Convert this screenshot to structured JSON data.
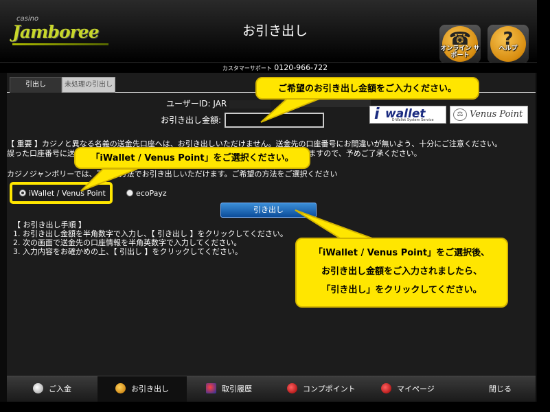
{
  "header": {
    "logo_small": "casino",
    "logo_main": "Jamboree",
    "title": "お引き出し",
    "online_support_label": "オンライン サポート",
    "help_label": "ヘルプ"
  },
  "support": {
    "label": "カスタマーサポート",
    "phone": "0120-966-722"
  },
  "tabs": {
    "withdraw": "引出し",
    "pending": "未処理の引出し"
  },
  "form": {
    "user_id_label": "ユーザーID: JAR",
    "amount_label": "お引き出し金額:",
    "amount_value": ""
  },
  "payment_logos": {
    "iwallet": "wallet",
    "iwallet_sub": "E-Wallet System Service",
    "venus": "Venus Point"
  },
  "notice": {
    "line1": "【 重要 】カジノと異なる名義の送金先口座へは、お引き出しいただけません。送金先の口座番号にお間違いが無いよう、十分にご注意ください。",
    "line2": "誤った口座番号に送金された場合のトラブルにつきましては、当カジノは責任を負いかねますので、予めご了承ください。",
    "line3": "カジノジャンボリーでは、下記の方法でお引き出しいただけます。ご希望の方法をご選択ください"
  },
  "methods": {
    "iwallet": "iWallet / Venus Point",
    "ecopayz": "ecoPayz",
    "selected": "iwallet"
  },
  "withdraw_button": "引き出し",
  "steps": {
    "heading": "【 お引き出し手順 】",
    "items": [
      "1. お引き出し金額を半角数字で入力し、【 引き出し 】をクリックしてください。",
      "2. 次の画面で送金先の口座情報を半角英数字で入力してください。",
      "3. 入力内容をお確かめの上、【 引出し 】をクリックしてください。"
    ]
  },
  "callouts": {
    "amount": "ご希望のお引き出し金額をご入力ください。",
    "select": "「iWallet / Venus Point」をご選択ください。",
    "steps_line1": "「iWallet / Venus Point」をご選択後、",
    "steps_line2": "お引き出し金額をご入力されましたら、",
    "steps_line3": "「引き出し」をクリックしてください。"
  },
  "nav": {
    "deposit": "ご入金",
    "withdraw": "お引き出し",
    "history": "取引履歴",
    "comp": "コンプポイント",
    "mypage": "マイページ",
    "close": "閉じる"
  },
  "colors": {
    "callout": "#ffe600",
    "button": "#1a64b8",
    "logo_green": "#c8d72a"
  }
}
